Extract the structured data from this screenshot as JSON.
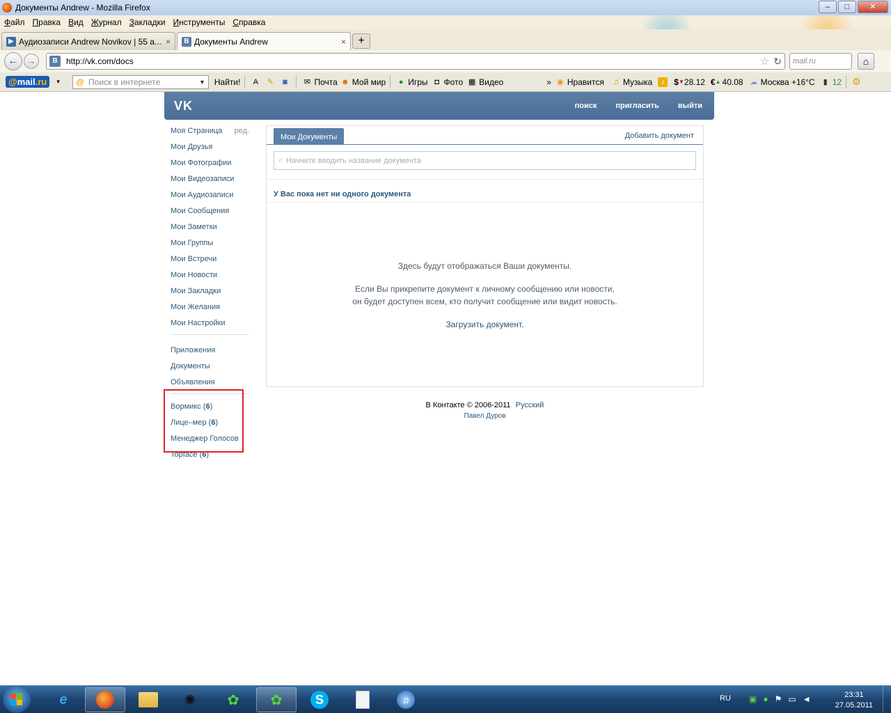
{
  "window": {
    "title": "Документы Andrew - Mozilla Firefox",
    "minimize": "–",
    "maximize": "□",
    "close": "✕"
  },
  "menu": [
    "Файл",
    "Правка",
    "Вид",
    "Журнал",
    "Закладки",
    "Инструменты",
    "Справка"
  ],
  "tabs": [
    {
      "label": "Аудиозаписи Andrew Novikov | 55 а...",
      "favicon": "▶",
      "color": "#3b6fa3"
    },
    {
      "label": "Документы Andrew",
      "favicon": "B",
      "color": "#5b7fa6"
    }
  ],
  "tab_close": "×",
  "new_tab": "+",
  "navbar": {
    "back": "←",
    "forward": "→",
    "url": "http://vk.com/docs",
    "url_favicon": "B",
    "search_placeholder": "mail.ru",
    "home": "⌂"
  },
  "mailru_toolbar": {
    "logo_at": "@",
    "logo_text": "mail",
    "logo_ru": ".ru",
    "search_placeholder": "Поиск в интернете",
    "find": "Найти!",
    "mail": "Почта",
    "my_world": "Мой мир",
    "games": "Игры",
    "photo": "Фото",
    "video": "Видео",
    "more": "»",
    "like": "Нравится",
    "music": "Музыка",
    "usd_symbol": "$",
    "usd": "28.12",
    "eur_symbol": "€",
    "eur": "40.08",
    "weather": "Москва +16°C",
    "traffic": "12"
  },
  "vk": {
    "logo": "VK",
    "nav": [
      "поиск",
      "пригласить",
      "выйти"
    ],
    "sidebar": {
      "main": [
        {
          "label": "Моя Страница",
          "extra": "ред."
        },
        {
          "label": "Мои Друзья"
        },
        {
          "label": "Мои Фотографии"
        },
        {
          "label": "Мои Видеозаписи"
        },
        {
          "label": "Мои Аудиозаписи"
        },
        {
          "label": "Мои Сообщения"
        },
        {
          "label": "Мои Заметки"
        },
        {
          "label": "Мои Группы"
        },
        {
          "label": "Мои Встречи"
        },
        {
          "label": "Мои Новости"
        },
        {
          "label": "Мои Закладки"
        },
        {
          "label": "Мои Желания"
        },
        {
          "label": "Мои Настройки"
        }
      ],
      "services": [
        "Приложения",
        "Документы",
        "Объявления"
      ],
      "apps": [
        {
          "label": "Вормикс",
          "count": "6"
        },
        {
          "label": "Лице–мер",
          "count": "6"
        },
        {
          "label": "Менеджер Голосов",
          "count": ""
        },
        {
          "label": "Topface",
          "count": "6"
        }
      ]
    },
    "docs": {
      "tab": "Мои Документы",
      "add": "Добавить документ",
      "search_placeholder": "Начните вводить название документа",
      "empty_title": "У Вас пока нет ни одного документа",
      "empty_line1": "Здесь будут отображаться Ваши документы.",
      "empty_line2": "Если Вы прикрепите документ к личному сообщению или новости,",
      "empty_line3": "он будет доступен всем, кто получит сообщение или видит новость.",
      "upload": "Загрузить документ."
    },
    "footer": {
      "copyright": "В Контакте © 2006-2011",
      "language": "Русский",
      "author": "Павел Дуров"
    }
  },
  "taskbar": {
    "lang": "RU",
    "time": "23:31",
    "date": "27.05.2011"
  }
}
